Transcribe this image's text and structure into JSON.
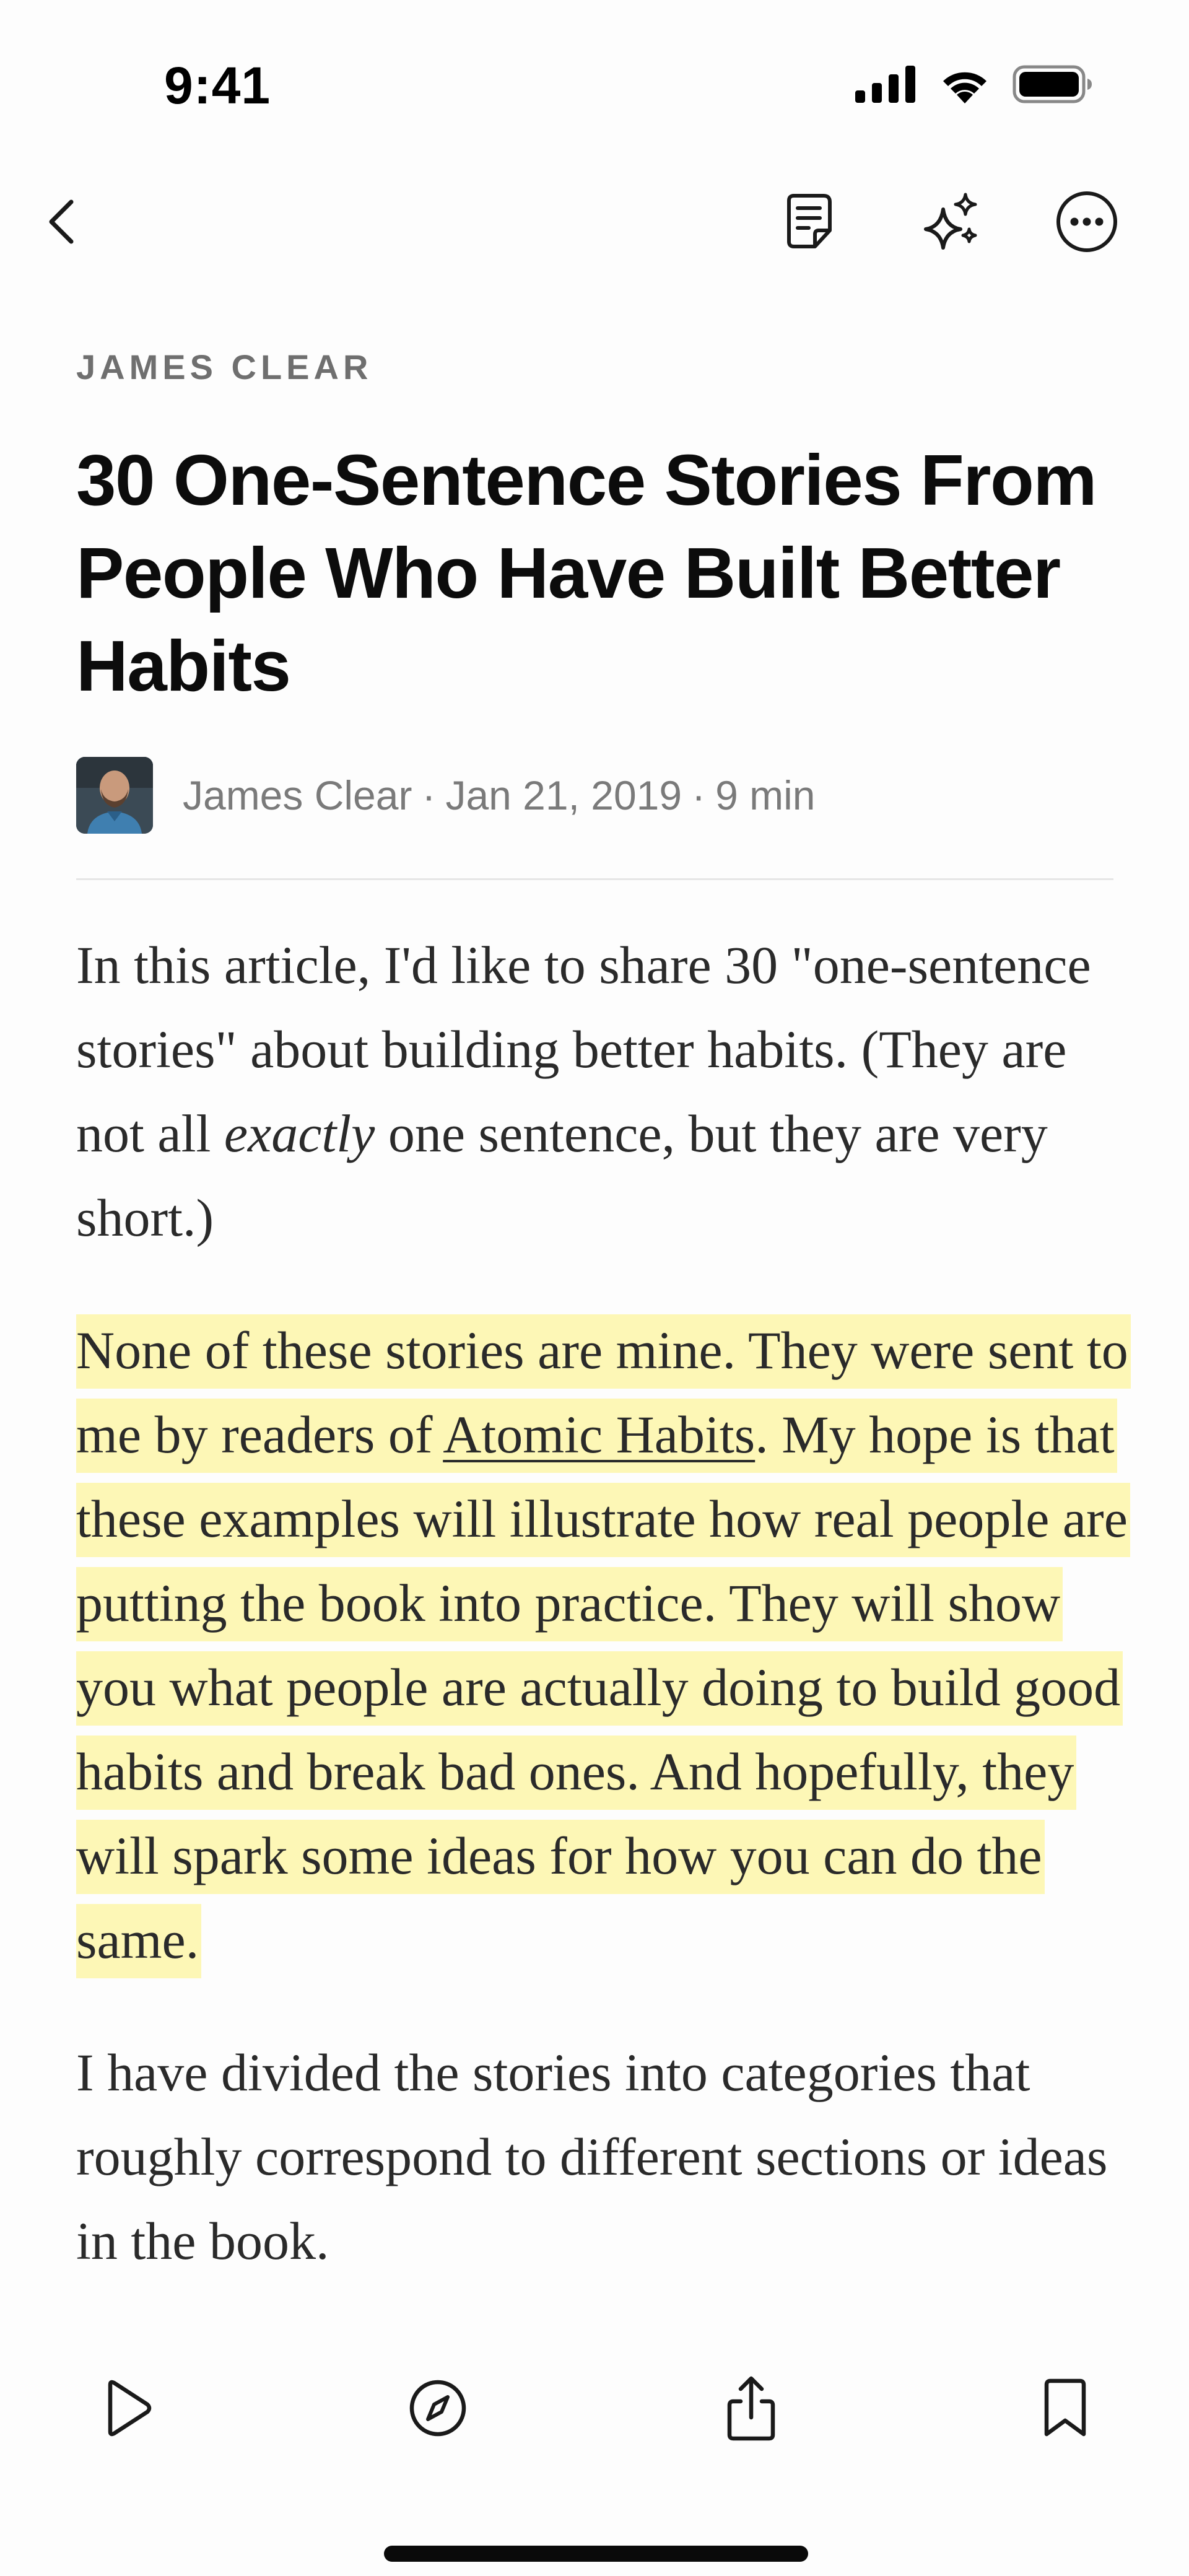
{
  "status_bar": {
    "time": "9:41",
    "icons": [
      "cellular-signal-icon",
      "wifi-icon",
      "battery-icon"
    ]
  },
  "nav": {
    "icons": [
      "chevron-left-icon",
      "notebook-icon",
      "sparkles-icon",
      "more-circle-icon"
    ]
  },
  "article": {
    "source": "JAMES CLEAR",
    "title": "30 One-Sentence Stories From People Who Have Built Better Habits",
    "author": "James Clear",
    "date": "Jan 21, 2019",
    "read_time": "9 min",
    "separator": "·",
    "paragraphs": {
      "p1_before": "In this article, I'd like to share 30 \"one-sentence stories\" about building better habits. (They are not all ",
      "p1_em": "exactly",
      "p1_after": " one sentence, but they are very short.)",
      "p2_before": "None of these stories are mine. They were sent to me by readers of ",
      "p2_link": "Atomic Habits",
      "p2_after": ". My hope is that these examples will illustrate how real people are putting the book into practice. They will show you what people are actually doing to build good habits and break bad ones. And hopefully, they will spark some ideas for how you can do the same.",
      "p3": "I have divided the stories into categories that roughly correspond to different sections or ideas in the book."
    },
    "highlight_color": "#fdf7b6"
  },
  "toolbar": {
    "icons": [
      "play-icon",
      "compass-icon",
      "share-icon",
      "bookmark-icon"
    ]
  }
}
